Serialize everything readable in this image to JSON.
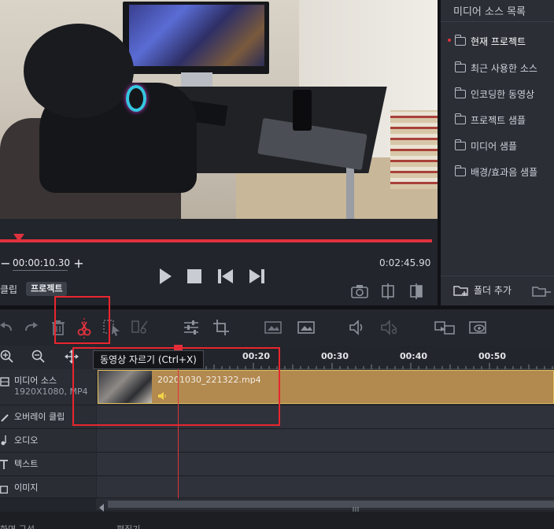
{
  "player": {
    "current_time": "00:00:10.30",
    "total_time": "0:02:45.90",
    "minus_label": "−",
    "plus_label": "+",
    "progress_fraction": 0.044
  },
  "tabs": {
    "clip_label": "클립",
    "project_label": "프로젝트"
  },
  "right_panel": {
    "title": "미디어 소스 목록",
    "items": [
      {
        "label": "현재 프로젝트",
        "icon": "folder-open-icon",
        "active": true
      },
      {
        "label": "최근 사용한 소스",
        "icon": "folder-icon"
      },
      {
        "label": "인코딩한 동영상",
        "icon": "folder-arrow-icon"
      },
      {
        "label": "프로젝트 샘플",
        "icon": "folder-icon"
      },
      {
        "label": "미디어 샘플",
        "icon": "folder-icon"
      },
      {
        "label": "배경/효과음 샘플",
        "icon": "folder-icon"
      }
    ],
    "add_folder_label": "폴더 추가"
  },
  "timeline": {
    "ruler_labels": [
      "00:20",
      "00:30",
      "00:40",
      "00:50"
    ],
    "tracks": [
      {
        "name": "미디어 소스",
        "sub": "1920X1080, MP4",
        "icon": "film-icon"
      },
      {
        "name": "오버레이 클립",
        "icon": "brush-icon"
      },
      {
        "name": "오디오",
        "icon": "music-note-icon"
      },
      {
        "name": "텍스트",
        "icon": "text-icon"
      },
      {
        "name": "이미지",
        "icon": "image-icon"
      }
    ],
    "clip_name": "20201030_221322.mp4"
  },
  "tooltip": "동영상 자르기 (Ctrl+X)",
  "footer": {
    "left": "화면 구성",
    "mid": "편집기"
  },
  "colors": {
    "accent": "#e0323e",
    "clip": "#b2894f",
    "highlight": "#e8262f"
  }
}
